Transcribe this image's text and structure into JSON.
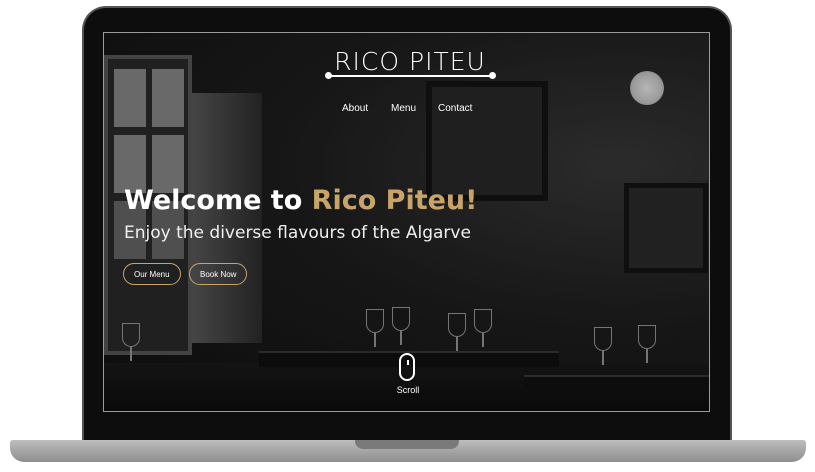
{
  "site": {
    "brand": "RICO PITEU",
    "nav": [
      {
        "label": "About"
      },
      {
        "label": "Menu"
      },
      {
        "label": "Contact"
      }
    ]
  },
  "hero": {
    "title_prefix": "Welcome to ",
    "title_accent": "Rico Piteu!",
    "subtitle": "Enjoy the diverse flavours of the Algarve",
    "buttons": [
      {
        "label": "Our Menu"
      },
      {
        "label": "Book Now"
      }
    ]
  },
  "scroll": {
    "label": "Scroll",
    "icon": "mouse-scroll-icon"
  },
  "colors": {
    "accent": "#c9a46a",
    "text": "#ffffff",
    "background": "#1a1a1a"
  }
}
